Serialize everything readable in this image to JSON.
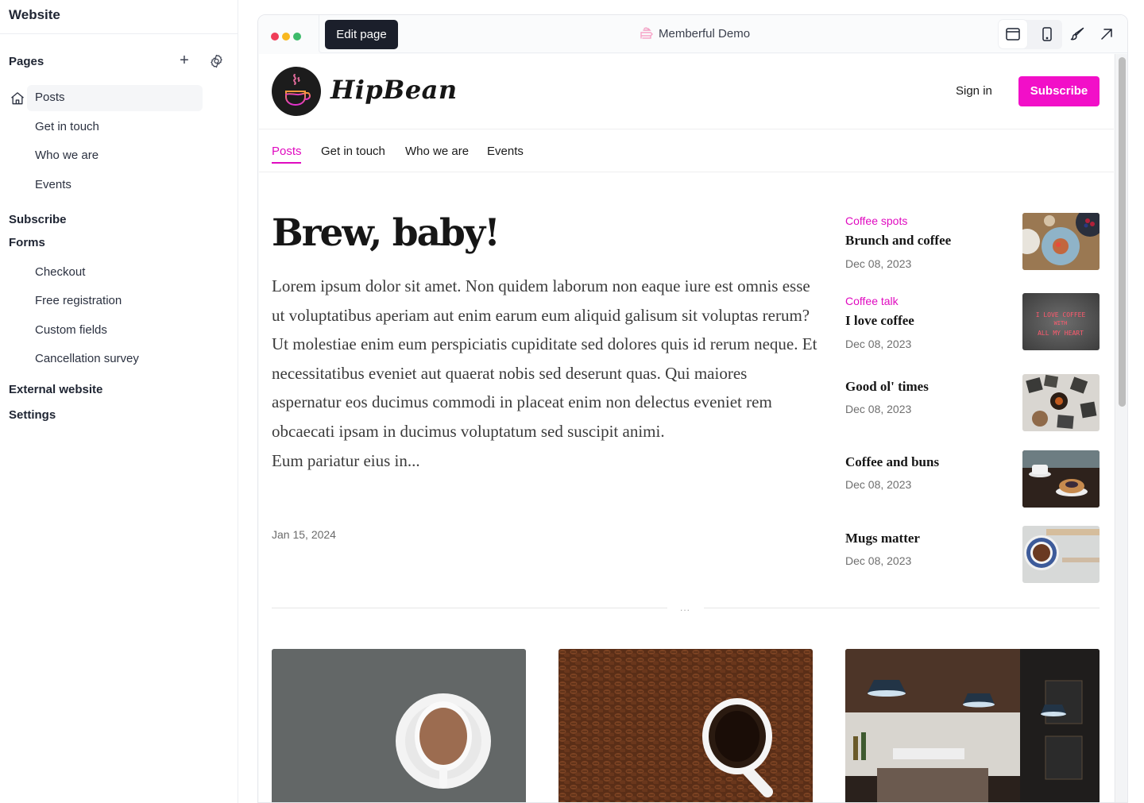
{
  "sidebar": {
    "title": "Website",
    "pages_label": "Pages",
    "pages": [
      {
        "label": "Posts",
        "home": true,
        "active": true
      },
      {
        "label": "Get in touch"
      },
      {
        "label": "Who we are"
      },
      {
        "label": "Events"
      }
    ],
    "subscribe_label": "Subscribe",
    "forms_label": "Forms",
    "forms": [
      {
        "label": "Checkout"
      },
      {
        "label": "Free registration"
      },
      {
        "label": "Custom fields"
      },
      {
        "label": "Cancellation survey"
      }
    ],
    "external_label": "External website",
    "settings_label": "Settings"
  },
  "toolbar": {
    "window_dots": [
      "#ef3d58",
      "#f8b820",
      "#3dbb6b"
    ],
    "edit_label": "Edit page",
    "site_name": "Memberful Demo",
    "icons": [
      "desktop-view-icon",
      "mobile-view-icon",
      "brush-icon",
      "external-link-icon"
    ]
  },
  "site": {
    "brand": "HipBean",
    "signin_label": "Sign in",
    "subscribe_label": "Subscribe",
    "accent": "#f20fc8",
    "nav": [
      {
        "label": "Posts",
        "active": true
      },
      {
        "label": "Get in touch"
      },
      {
        "label": "Who we are"
      },
      {
        "label": "Events"
      }
    ],
    "hero": {
      "title": "Brew, baby!",
      "body": "Lorem ipsum dolor sit amet. Non quidem laborum non eaque iure est omnis esse ut voluptatibus aperiam aut enim earum eum aliquid galisum sit voluptas rerum? Ut molestiae enim eum perspiciatis cupiditate sed dolores quis id rerum neque. Et necessitatibus eveniet aut quaerat nobis sed deserunt quas. Qui maiores aspernatur eos ducimus commodi in placeat enim non delectus eveniet rem obcaecati ipsam in ducimus voluptatum sed suscipit animi.",
      "body_more": "Eum pariatur eius in...",
      "date": "Jan 15, 2024"
    },
    "posts": [
      {
        "category": "Coffee spots",
        "title": "Brunch and coffee",
        "date": "Dec 08, 2023",
        "image": "brunch-photo"
      },
      {
        "category": "Coffee talk",
        "title": "I love coffee",
        "date": "Dec 08, 2023",
        "image": "neon-sign-photo",
        "neon_text": "I LOVE COFFEE WITH ALL MY HEART"
      },
      {
        "category": "",
        "title": "Good ol' times",
        "date": "Dec 08, 2023",
        "image": "old-photos-photo"
      },
      {
        "category": "",
        "title": "Coffee and buns",
        "date": "Dec 08, 2023",
        "image": "buns-photo"
      },
      {
        "category": "",
        "title": "Mugs matter",
        "date": "Dec 08, 2023",
        "image": "mug-photo"
      }
    ],
    "divider_label": "...",
    "cards": [
      {
        "image": "cup-on-slate-photo"
      },
      {
        "image": "cup-on-beans-photo"
      },
      {
        "image": "cafe-interior-photo"
      }
    ]
  }
}
